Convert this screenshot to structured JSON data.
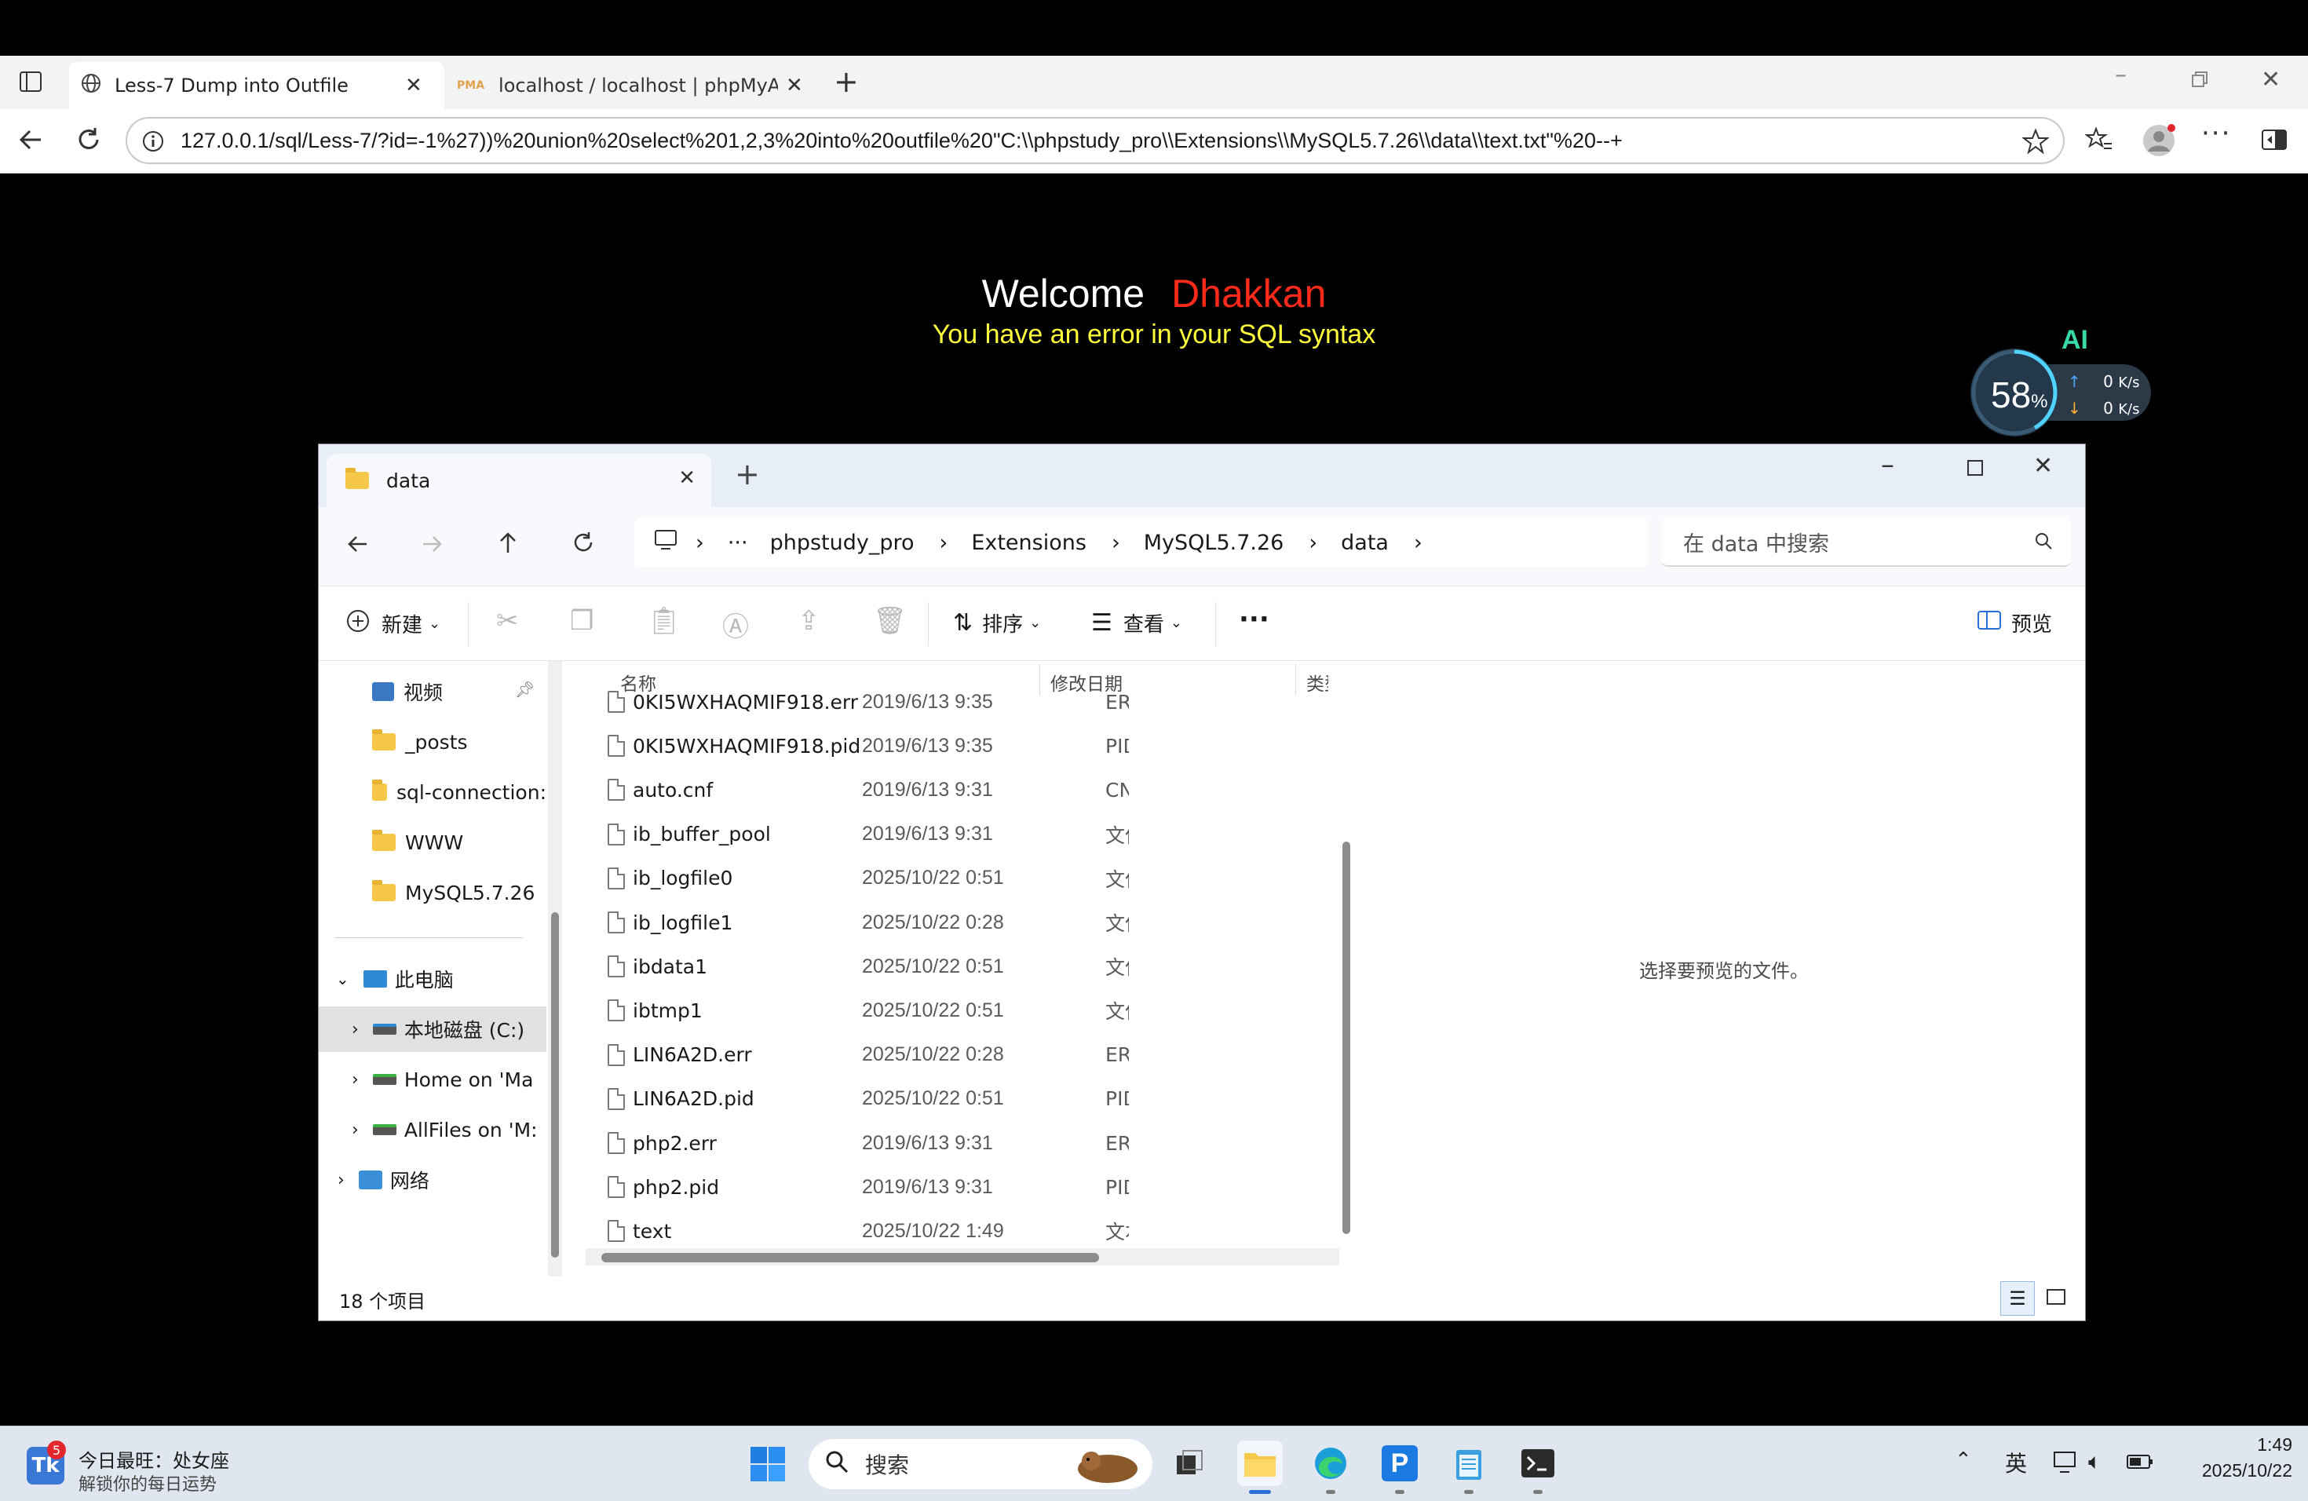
{
  "browser": {
    "tabs": [
      {
        "title": "Less-7 Dump into Outfile",
        "active": true
      },
      {
        "title": "localhost / localhost | phpMyAdm",
        "active": false
      }
    ],
    "url": "127.0.0.1/sql/Less-7/?id=-1%27))%20union%20select%201,2,3%20into%20outfile%20\"C:\\\\phpstudy_pro\\\\Extensions\\\\MySQL5.7.26\\\\data\\\\text.txt\"%20--+"
  },
  "page": {
    "welcome": "Welcome",
    "name": "Dhakkan",
    "error": "You have an error in your SQL syntax"
  },
  "monitor": {
    "percent": "58",
    "percent_sign": "%",
    "up": "0",
    "down": "0",
    "unit": "K/s",
    "badge": "AI"
  },
  "explorer": {
    "tab_title": "data",
    "breadcrumb": [
      "phpstudy_pro",
      "Extensions",
      "MySQL5.7.26",
      "data"
    ],
    "search_placeholder": "在 data 中搜索",
    "toolbar": {
      "new": "新建",
      "sort": "排序",
      "view": "查看",
      "more": "···",
      "preview": "预览"
    },
    "sidebar": {
      "items": [
        {
          "label": "视频"
        },
        {
          "label": "_posts"
        },
        {
          "label": "sql-connection:"
        },
        {
          "label": "WWW"
        },
        {
          "label": "MySQL5.7.26"
        },
        {
          "label": "此电脑"
        },
        {
          "label": "本地磁盘 (C:)"
        },
        {
          "label": "Home on 'Ma"
        },
        {
          "label": "AllFiles on 'M:"
        },
        {
          "label": "网络"
        }
      ]
    },
    "columns": {
      "name": "名称",
      "date": "修改日期",
      "type": "类型"
    },
    "files": [
      {
        "name": "0KI5WXHAQMIF918.err",
        "date": "2019/6/13 9:35",
        "type": "ER"
      },
      {
        "name": "0KI5WXHAQMIF918.pid",
        "date": "2019/6/13 9:35",
        "type": "PID"
      },
      {
        "name": "auto.cnf",
        "date": "2019/6/13 9:31",
        "type": "CN"
      },
      {
        "name": "ib_buffer_pool",
        "date": "2019/6/13 9:31",
        "type": "文件"
      },
      {
        "name": "ib_logfile0",
        "date": "2025/10/22 0:51",
        "type": "文件"
      },
      {
        "name": "ib_logfile1",
        "date": "2025/10/22 0:28",
        "type": "文件"
      },
      {
        "name": "ibdata1",
        "date": "2025/10/22 0:51",
        "type": "文件"
      },
      {
        "name": "ibtmp1",
        "date": "2025/10/22 0:51",
        "type": "文件"
      },
      {
        "name": "LIN6A2D.err",
        "date": "2025/10/22 0:28",
        "type": "ER"
      },
      {
        "name": "LIN6A2D.pid",
        "date": "2025/10/22 0:51",
        "type": "PID"
      },
      {
        "name": "php2.err",
        "date": "2019/6/13 9:31",
        "type": "ER"
      },
      {
        "name": "php2.pid",
        "date": "2019/6/13 9:31",
        "type": "PID"
      },
      {
        "name": "text",
        "date": "2025/10/22 1:49",
        "type": "文本"
      }
    ],
    "preview_text": "选择要预览的文件。",
    "status": "18 个项目"
  },
  "taskbar": {
    "news_badge": "5",
    "news_title": "今日最旺：处女座",
    "news_sub": "解锁你的每日运势",
    "search": "搜索",
    "lang": "英",
    "time": "1:49",
    "date": "2025/10/22"
  }
}
